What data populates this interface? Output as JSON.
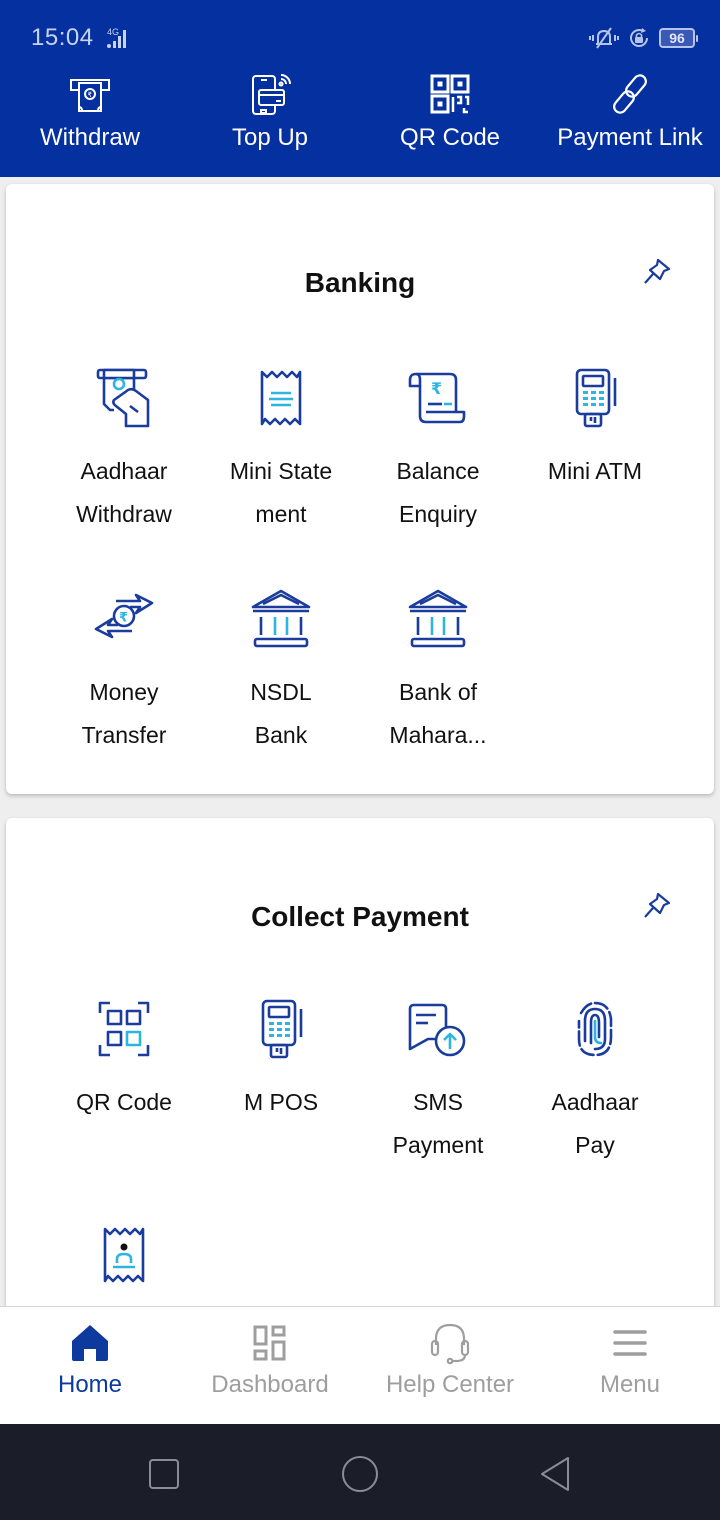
{
  "status_bar": {
    "time": "15:04",
    "network": "4G",
    "battery": "96",
    "icons": [
      "vibrate-mute-icon",
      "rotation-lock-icon",
      "battery-icon"
    ]
  },
  "quick_actions": [
    {
      "label": "Withdraw",
      "icon": "atm-withdraw-icon"
    },
    {
      "label": "Top Up",
      "icon": "phone-card-topup-icon"
    },
    {
      "label": "QR Code",
      "icon": "qr-code-icon"
    },
    {
      "label": "Payment Link",
      "icon": "link-icon"
    }
  ],
  "sections": [
    {
      "title": "Banking",
      "pin_icon": "pin-icon",
      "items": [
        {
          "label": "Aadhaar\nWithdraw",
          "icon": "aadhaar-withdraw-icon"
        },
        {
          "label": "Mini State\nment",
          "icon": "receipt-icon"
        },
        {
          "label": "Balance\nEnquiry",
          "icon": "rupee-scroll-icon"
        },
        {
          "label": "Mini ATM",
          "icon": "card-terminal-icon"
        },
        {
          "label": "Money\nTransfer",
          "icon": "money-transfer-icon"
        },
        {
          "label": "NSDL\nBank",
          "icon": "bank-icon"
        },
        {
          "label": "Bank of\nMahara...",
          "icon": "bank-icon"
        }
      ]
    },
    {
      "title": "Collect Payment",
      "pin_icon": "pin-icon",
      "items": [
        {
          "label": "QR Code",
          "icon": "qr-scan-icon"
        },
        {
          "label": "M POS",
          "icon": "card-terminal-icon"
        },
        {
          "label": "SMS\nPayment",
          "icon": "sms-payment-icon"
        },
        {
          "label": "Aadhaar\nPay",
          "icon": "fingerprint-icon"
        },
        {
          "label": "",
          "icon": "bill-receipt-icon"
        }
      ]
    }
  ],
  "bottom_nav": [
    {
      "label": "Home",
      "icon": "home-icon",
      "active": true
    },
    {
      "label": "Dashboard",
      "icon": "dashboard-icon",
      "active": false
    },
    {
      "label": "Help Center",
      "icon": "headset-icon",
      "active": false
    },
    {
      "label": "Menu",
      "icon": "hamburger-menu-icon",
      "active": false
    }
  ],
  "colors": {
    "brand": "#0530a0",
    "icon_dark": "#1a3c9c",
    "icon_accent": "#2cb5e0",
    "nav_active": "#0d3a9c",
    "nav_inactive": "#9e9e9e"
  }
}
